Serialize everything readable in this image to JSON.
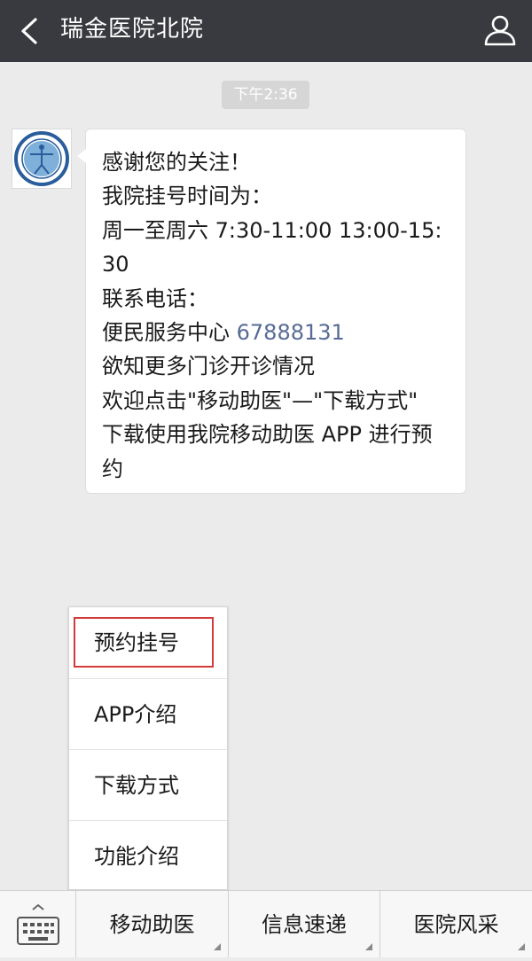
{
  "header": {
    "back_icon": "chevron-left-icon",
    "title": "瑞金医院北院",
    "user_icon": "user-icon"
  },
  "chat": {
    "timestamp": "下午2:36",
    "avatar_icon": "hospital-logo",
    "message_lines": [
      "感谢您的关注！",
      "我院挂号时间为：",
      "周一至周六 7:30-11:00 13:00-15:",
      "30",
      "联系电话：",
      "便民服务中心",
      "欲知更多门诊开诊情况",
      "欢迎点击\"移动助医\"—\"下载方式\"",
      "下载使用我院移动助医 APP 进行预",
      "约"
    ],
    "phone_number": "67888131"
  },
  "menu": {
    "items": [
      "预约挂号",
      "APP介绍",
      "下载方式",
      "功能介绍"
    ],
    "highlight_color": "#d33a3a"
  },
  "bottom_bar": {
    "keyboard_icon": "keyboard-icon",
    "tabs": [
      "移动助医",
      "信息速递",
      "医院风采"
    ]
  },
  "colors": {
    "header_bg": "#393a3f",
    "chat_bg": "#ebebeb",
    "link": "#576b95"
  }
}
